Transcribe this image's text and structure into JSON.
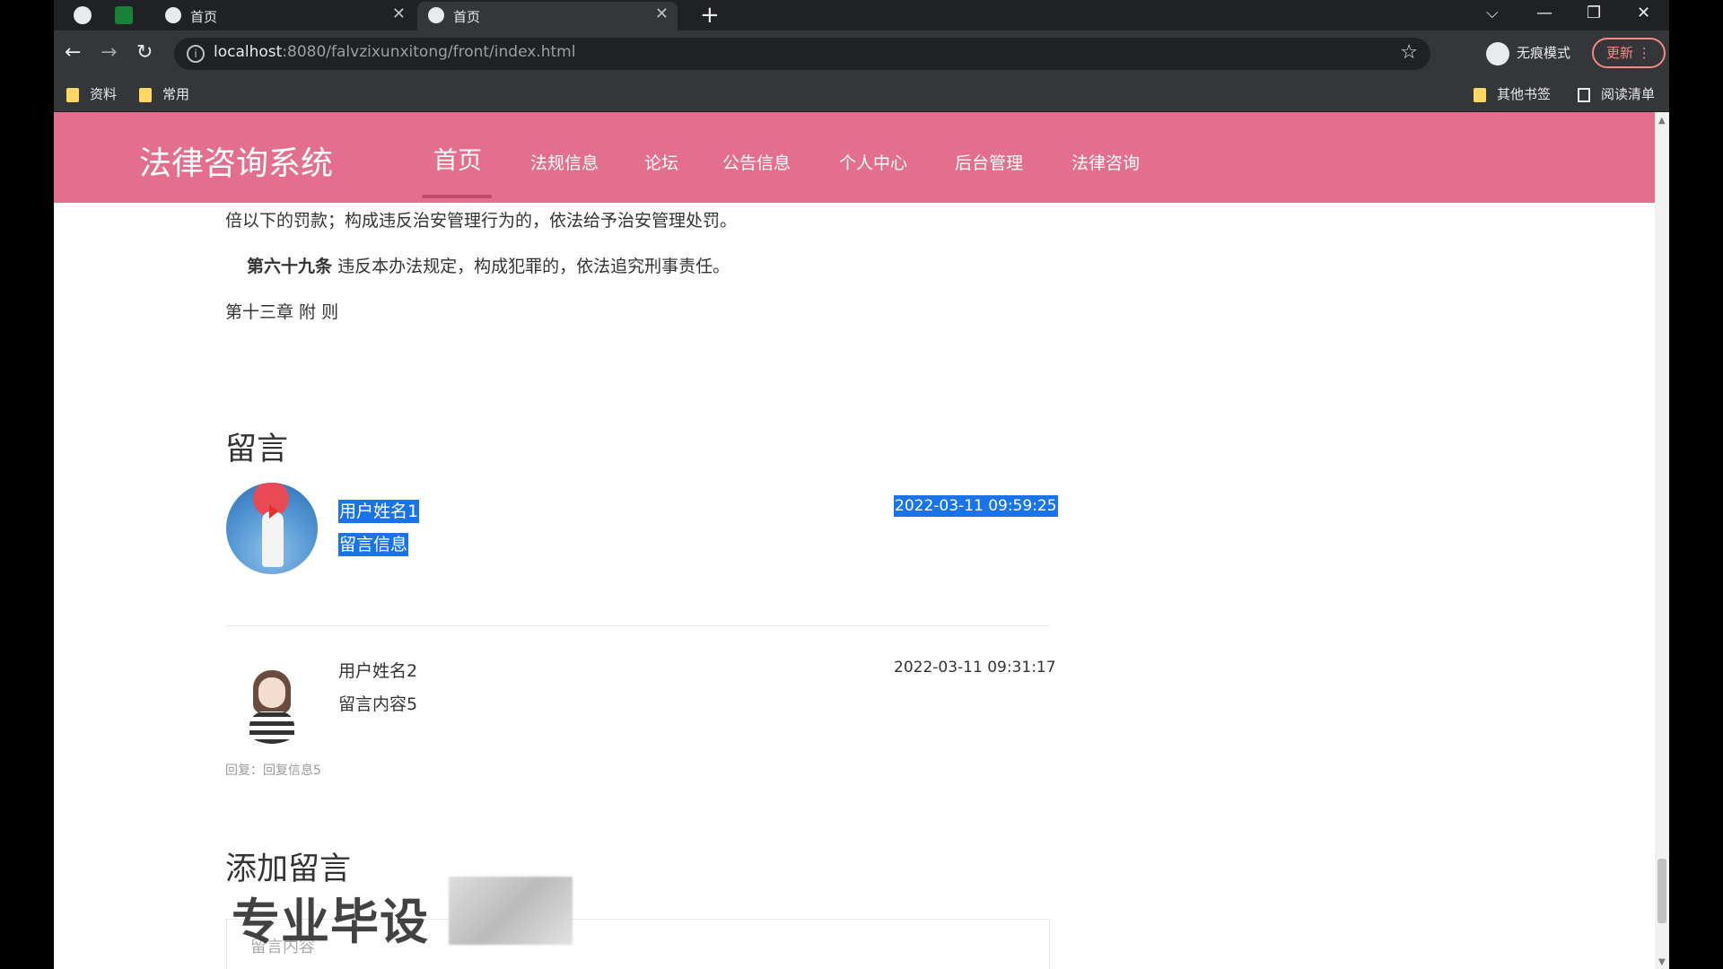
{
  "browser": {
    "tabs": [
      {
        "label": "首页",
        "active": false
      },
      {
        "label": "首页",
        "active": true
      }
    ],
    "url_host": "localhost",
    "url_rest": ":8080/falvzixunxitong/front/index.html",
    "incognito_label": "无痕模式",
    "update_label": "更新",
    "bookmarks": [
      "资料",
      "常用"
    ],
    "other_bookmarks": "其他书签",
    "reading_list": "阅读清单"
  },
  "nav": {
    "brand": "法律咨询系统",
    "links": [
      "首页",
      "法规信息",
      "论坛",
      "公告信息",
      "个人中心",
      "后台管理",
      "法律咨询"
    ]
  },
  "article": {
    "line1": "倍以下的罚款；构成违反治安管理行为的，依法给予治安管理处罚。",
    "article_num": "第六十九条",
    "article_text": "违反本办法规定，构成犯罪的，依法追究刑事责任。",
    "chapter": "第十三章 附 则"
  },
  "comments": {
    "title": "留言",
    "items": [
      {
        "user": "用户姓名1",
        "content": "留言信息",
        "time": "2022-03-11 09:59:25",
        "reply": ""
      },
      {
        "user": "用户姓名2",
        "content": "留言内容5",
        "time": "2022-03-11 09:31:17",
        "reply": "回复：回复信息5"
      }
    ]
  },
  "add_comment": {
    "title": "添加留言",
    "placeholder": "留言内容"
  },
  "watermark": "专业毕设",
  "colors": {
    "nav_bg": "#e46e8d",
    "selection": "#1a73e8"
  }
}
